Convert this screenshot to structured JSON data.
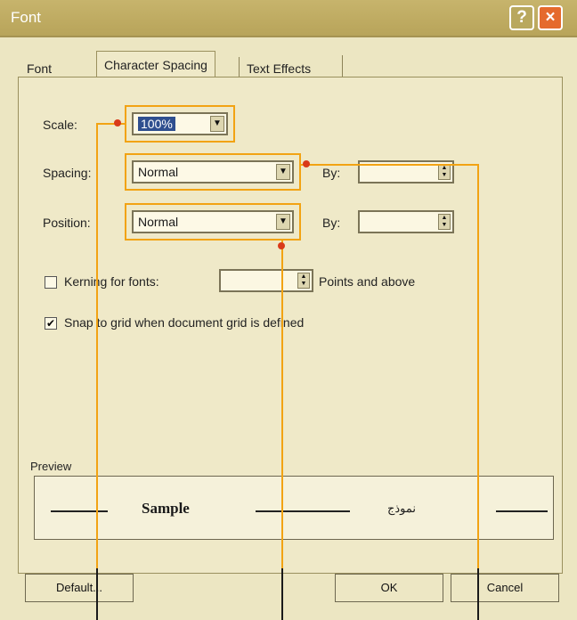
{
  "dialog": {
    "title": "Font"
  },
  "tabs": {
    "font": "Font",
    "spacing": "Character Spacing",
    "effects": "Text Effects"
  },
  "scale": {
    "label": "Scale:",
    "value": "100%"
  },
  "spacing": {
    "label": "Spacing:",
    "value": "Normal",
    "by_label": "By:",
    "by_value": ""
  },
  "position": {
    "label": "Position:",
    "value": "Normal",
    "by_label": "By:",
    "by_value": ""
  },
  "kerning": {
    "label": "Kerning for fonts:",
    "value": "",
    "suffix": "Points and above",
    "checked": false
  },
  "snap": {
    "label": "Snap to grid when document grid is defined",
    "checked": true
  },
  "preview": {
    "label": "Preview",
    "latin_sample": "Sample",
    "arabic_sample": "نموذج"
  },
  "buttons": {
    "default": "Default...",
    "ok": "OK",
    "cancel": "Cancel"
  },
  "icons": {
    "help": "?",
    "close": "×",
    "dropdown": "▼",
    "spin_up": "▲",
    "spin_down": "▼",
    "check": "✔"
  },
  "colors": {
    "highlight": "#f2a313",
    "title_bar": "#b8a45a",
    "close_button": "#e56a2d"
  }
}
